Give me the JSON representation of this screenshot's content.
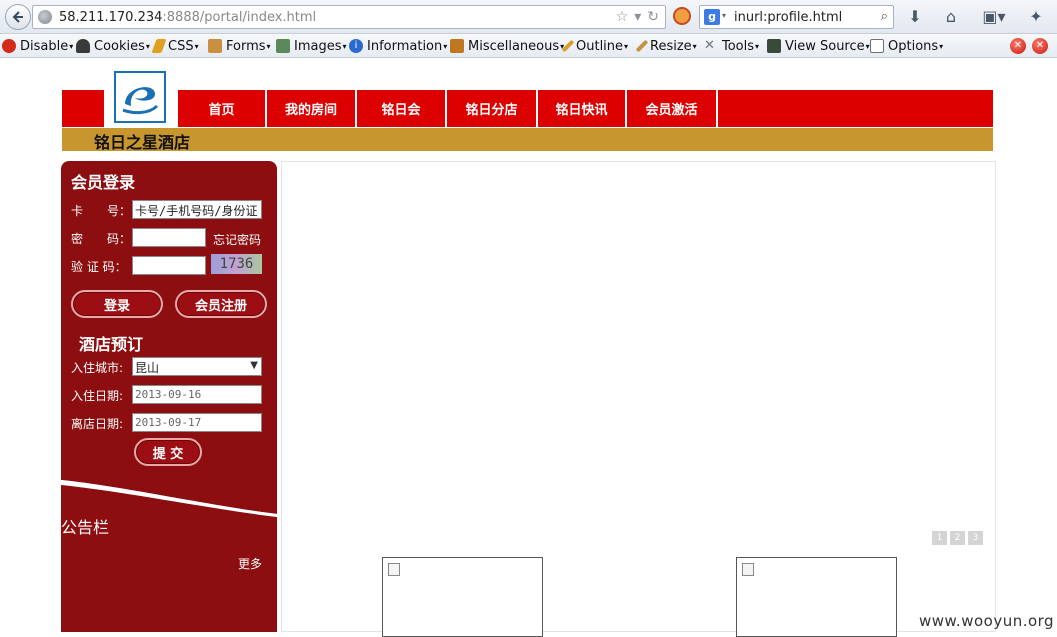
{
  "browser": {
    "url_host": "58.211.170.234",
    "url_rest": ":8888/portal/index.html",
    "search_query": "inurl:profile.html"
  },
  "devtoolbar": {
    "items": [
      {
        "label": "Disable",
        "icon": "disable-icon",
        "color": "#d42a1a"
      },
      {
        "label": "Cookies",
        "icon": "cookies-icon",
        "color": "#3a3a3a"
      },
      {
        "label": "CSS",
        "icon": "css-icon",
        "color": "#e0a020"
      },
      {
        "label": "Forms",
        "icon": "forms-icon",
        "color": "#c89040"
      },
      {
        "label": "Images",
        "icon": "images-icon",
        "color": "#5a8a5a"
      },
      {
        "label": "Information",
        "icon": "information-icon",
        "color": "#2a6ad0"
      },
      {
        "label": "Miscellaneous",
        "icon": "miscellaneous-icon",
        "color": "#c07820"
      },
      {
        "label": "Outline",
        "icon": "outline-icon",
        "color": "#d8a030"
      },
      {
        "label": "Resize",
        "icon": "resize-icon",
        "color": "#c89040"
      },
      {
        "label": "Tools",
        "icon": "tools-icon",
        "color": "#6a7280"
      },
      {
        "label": "View Source",
        "icon": "view-source-icon",
        "color": "#3a4a3a"
      },
      {
        "label": "Options",
        "icon": "options-icon",
        "color": "#707070"
      }
    ]
  },
  "site": {
    "menu": [
      "首页",
      "我的房间",
      "铭日会",
      "铭日分店",
      "铭日快讯",
      "会员激活"
    ],
    "hotel_name": "铭日之星酒店",
    "accent": "#dd0000",
    "sidebar_color": "#8c0e10",
    "subbar_color": "#c8962e"
  },
  "login": {
    "title": "会员登录",
    "card_label": "卡　　号：",
    "card_placeholder": "卡号/手机号码/身份证",
    "password_label": "密　　码：",
    "forgot": "忘记密码",
    "captcha_label": "验 证 码：",
    "captcha_code": "1736",
    "login_btn": "登录",
    "register_btn": "会员注册"
  },
  "booking": {
    "title": "酒店预订",
    "city_label": "入住城市:",
    "city_value": "昆山",
    "checkin_label": "入住日期:",
    "checkin_value": "2013-09-16",
    "checkout_label": "离店日期:",
    "checkout_value": "2013-09-17",
    "submit_btn": "提 交"
  },
  "notice": {
    "title": "公告栏",
    "more": "更多"
  },
  "pager": [
    "1",
    "2",
    "3"
  ],
  "watermark": "www.wooyun.org"
}
